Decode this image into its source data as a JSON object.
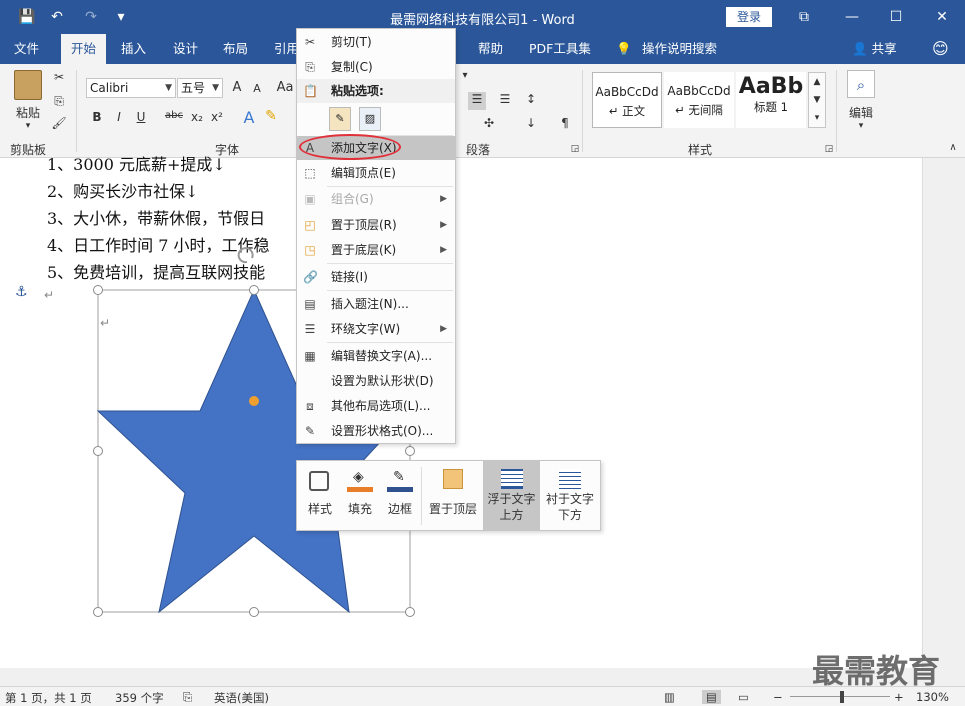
{
  "title": "最需网络科技有限公司1 - Word",
  "quick_access": {
    "save": "💾",
    "undo": "↶",
    "redo": "↷",
    "customize": "▾"
  },
  "login_label": "登录",
  "tabs": [
    "文件",
    "开始",
    "插入",
    "设计",
    "布局",
    "引用",
    "帮助",
    "PDF工具集",
    "操作说明搜索",
    "共享"
  ],
  "ribbon": {
    "clipboard": {
      "paste": "粘贴",
      "group": "剪贴板"
    },
    "font": {
      "name": "Calibri",
      "size": "五号",
      "group": "字体",
      "grow": "A",
      "shrink": "A",
      "case": "Aa",
      "bold": "B",
      "italic": "I",
      "underline": "U",
      "strike": "abc",
      "sub": "x₂",
      "sup": "x²",
      "effects": "A"
    },
    "paragraph": {
      "group": "段落"
    },
    "styles": {
      "group": "样式",
      "items": [
        {
          "preview": "AaBbCcDd",
          "name": "↵ 正文"
        },
        {
          "preview": "AaBbCcDd",
          "name": "↵ 无间隔"
        },
        {
          "preview": "AaBb",
          "name": "标题 1"
        }
      ]
    },
    "editing": {
      "label": "编辑"
    }
  },
  "document": {
    "lines": [
      "1、3000 元底薪+提成↓",
      "2、购买长沙市社保↓",
      "3、大小休，带薪休假，节假日",
      "4、日工作时间 7 小时，工作稳",
      "5、免费培训，提高互联网技能"
    ],
    "pilcrow": "↵",
    "anchor": "⚓"
  },
  "context_menu": [
    {
      "label": "剪切(T)",
      "icon": "✂",
      "disabled": false
    },
    {
      "label": "复制(C)",
      "icon": "⎘",
      "disabled": false
    },
    {
      "label": "粘贴选项:",
      "icon": "📋",
      "disabled": false
    },
    {
      "label": "添加文字(X)",
      "icon": "A",
      "disabled": false,
      "highlight": true
    },
    {
      "label": "编辑顶点(E)",
      "icon": "⬚",
      "disabled": false
    },
    {
      "label": "组合(G)",
      "icon": "▣",
      "disabled": true,
      "submenu": true
    },
    {
      "label": "置于顶层(R)",
      "icon": "◰",
      "disabled": false,
      "submenu": true
    },
    {
      "label": "置于底层(K)",
      "icon": "◳",
      "disabled": false,
      "submenu": true
    },
    {
      "label": "链接(I)",
      "icon": "🔗",
      "disabled": false
    },
    {
      "label": "插入题注(N)...",
      "icon": "▤",
      "disabled": false
    },
    {
      "label": "环绕文字(W)",
      "icon": "☰",
      "disabled": false,
      "submenu": true
    },
    {
      "label": "编辑替换文字(A)...",
      "icon": "▦",
      "disabled": false
    },
    {
      "label": "设置为默认形状(D)",
      "icon": "",
      "disabled": false
    },
    {
      "label": "其他布局选项(L)...",
      "icon": "⧈",
      "disabled": false
    },
    {
      "label": "设置形状格式(O)...",
      "icon": "✎",
      "disabled": false
    }
  ],
  "mini_toolbar": [
    {
      "label": "样式"
    },
    {
      "label": "填充"
    },
    {
      "label": "边框"
    },
    {
      "label": "置于顶层"
    },
    {
      "label": "浮于文字上方",
      "active": true
    },
    {
      "label": "衬于文字下方"
    }
  ],
  "status": {
    "page": "第 1 页，共 1 页",
    "words": "359 个字",
    "lang": "英语(美国)",
    "zoom": "130%"
  },
  "watermark": "最需教育",
  "colors": {
    "brand": "#2b579a",
    "star": "#4472c4",
    "highlight_ring": "#e0303a"
  }
}
